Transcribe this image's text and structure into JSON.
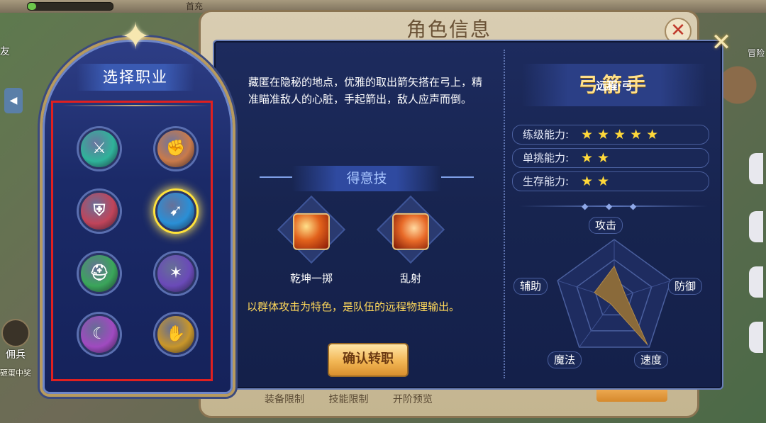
{
  "background": {
    "top_texts": [
      "首充"
    ],
    "left_friend": "友",
    "left_arrow": "◀",
    "left_merc": "佣兵",
    "left_egg": "砸蛋中奖",
    "right_adv": "冒险"
  },
  "back_panel": {
    "title": "角色信息",
    "close_icon": "✕",
    "tabs": [
      "装备限制",
      "技能限制",
      "开阶预览"
    ]
  },
  "main_panel": {
    "close_icon": "✕",
    "description": "藏匿在隐秘的地点，优雅的取出箭矢搭在弓上，精准瞄准敌人的心脏，手起箭出，敌人应声而倒。",
    "skills_header": "得意技",
    "skills": [
      {
        "name": "乾坤一掷",
        "icon": "fire-slash-icon"
      },
      {
        "name": "乱射",
        "icon": "arrow-rain-icon"
      }
    ],
    "feature": "以群体攻击为特色，是队伍的远程物理输出。",
    "confirm_button": "确认转职"
  },
  "class_info": {
    "name": "弓箭手",
    "type": "远程·弓",
    "stats": [
      {
        "label": "练级能力:",
        "stars": 5,
        "stars_text": "★★★★★"
      },
      {
        "label": "单挑能力:",
        "stars": 2,
        "stars_text": "★★"
      },
      {
        "label": "生存能力:",
        "stars": 2,
        "stars_text": "★★"
      }
    ],
    "radar": {
      "labels": [
        "攻击",
        "防御",
        "速度",
        "魔法",
        "辅助"
      ],
      "values": [
        0.55,
        0.2,
        0.95,
        0.1,
        0.35
      ],
      "fill_color": "#8a6a3a"
    }
  },
  "select_panel": {
    "title": "选择职业",
    "classes": [
      {
        "name": "warrior",
        "icon": "sword-emblem-icon",
        "color": "#2fb39a",
        "glyph": "⚔"
      },
      {
        "name": "fighter",
        "icon": "fist-emblem-icon",
        "color": "#c97a4a",
        "glyph": "✊"
      },
      {
        "name": "guardian",
        "icon": "shield-emblem-icon",
        "color": "#c0445a",
        "glyph": "⛨"
      },
      {
        "name": "archer",
        "icon": "bow-emblem-icon",
        "color": "#2a8fd6",
        "glyph": "➹",
        "selected": true
      },
      {
        "name": "knight",
        "icon": "helmet-emblem-icon",
        "color": "#3aa65a",
        "glyph": "⛑"
      },
      {
        "name": "mage",
        "icon": "flame-emblem-icon",
        "color": "#6a4ab8",
        "glyph": "✶"
      },
      {
        "name": "priest",
        "icon": "moon-emblem-icon",
        "color": "#a04ac0",
        "glyph": "☾"
      },
      {
        "name": "monk",
        "icon": "palm-emblem-icon",
        "color": "#c8962a",
        "glyph": "✋"
      }
    ]
  }
}
